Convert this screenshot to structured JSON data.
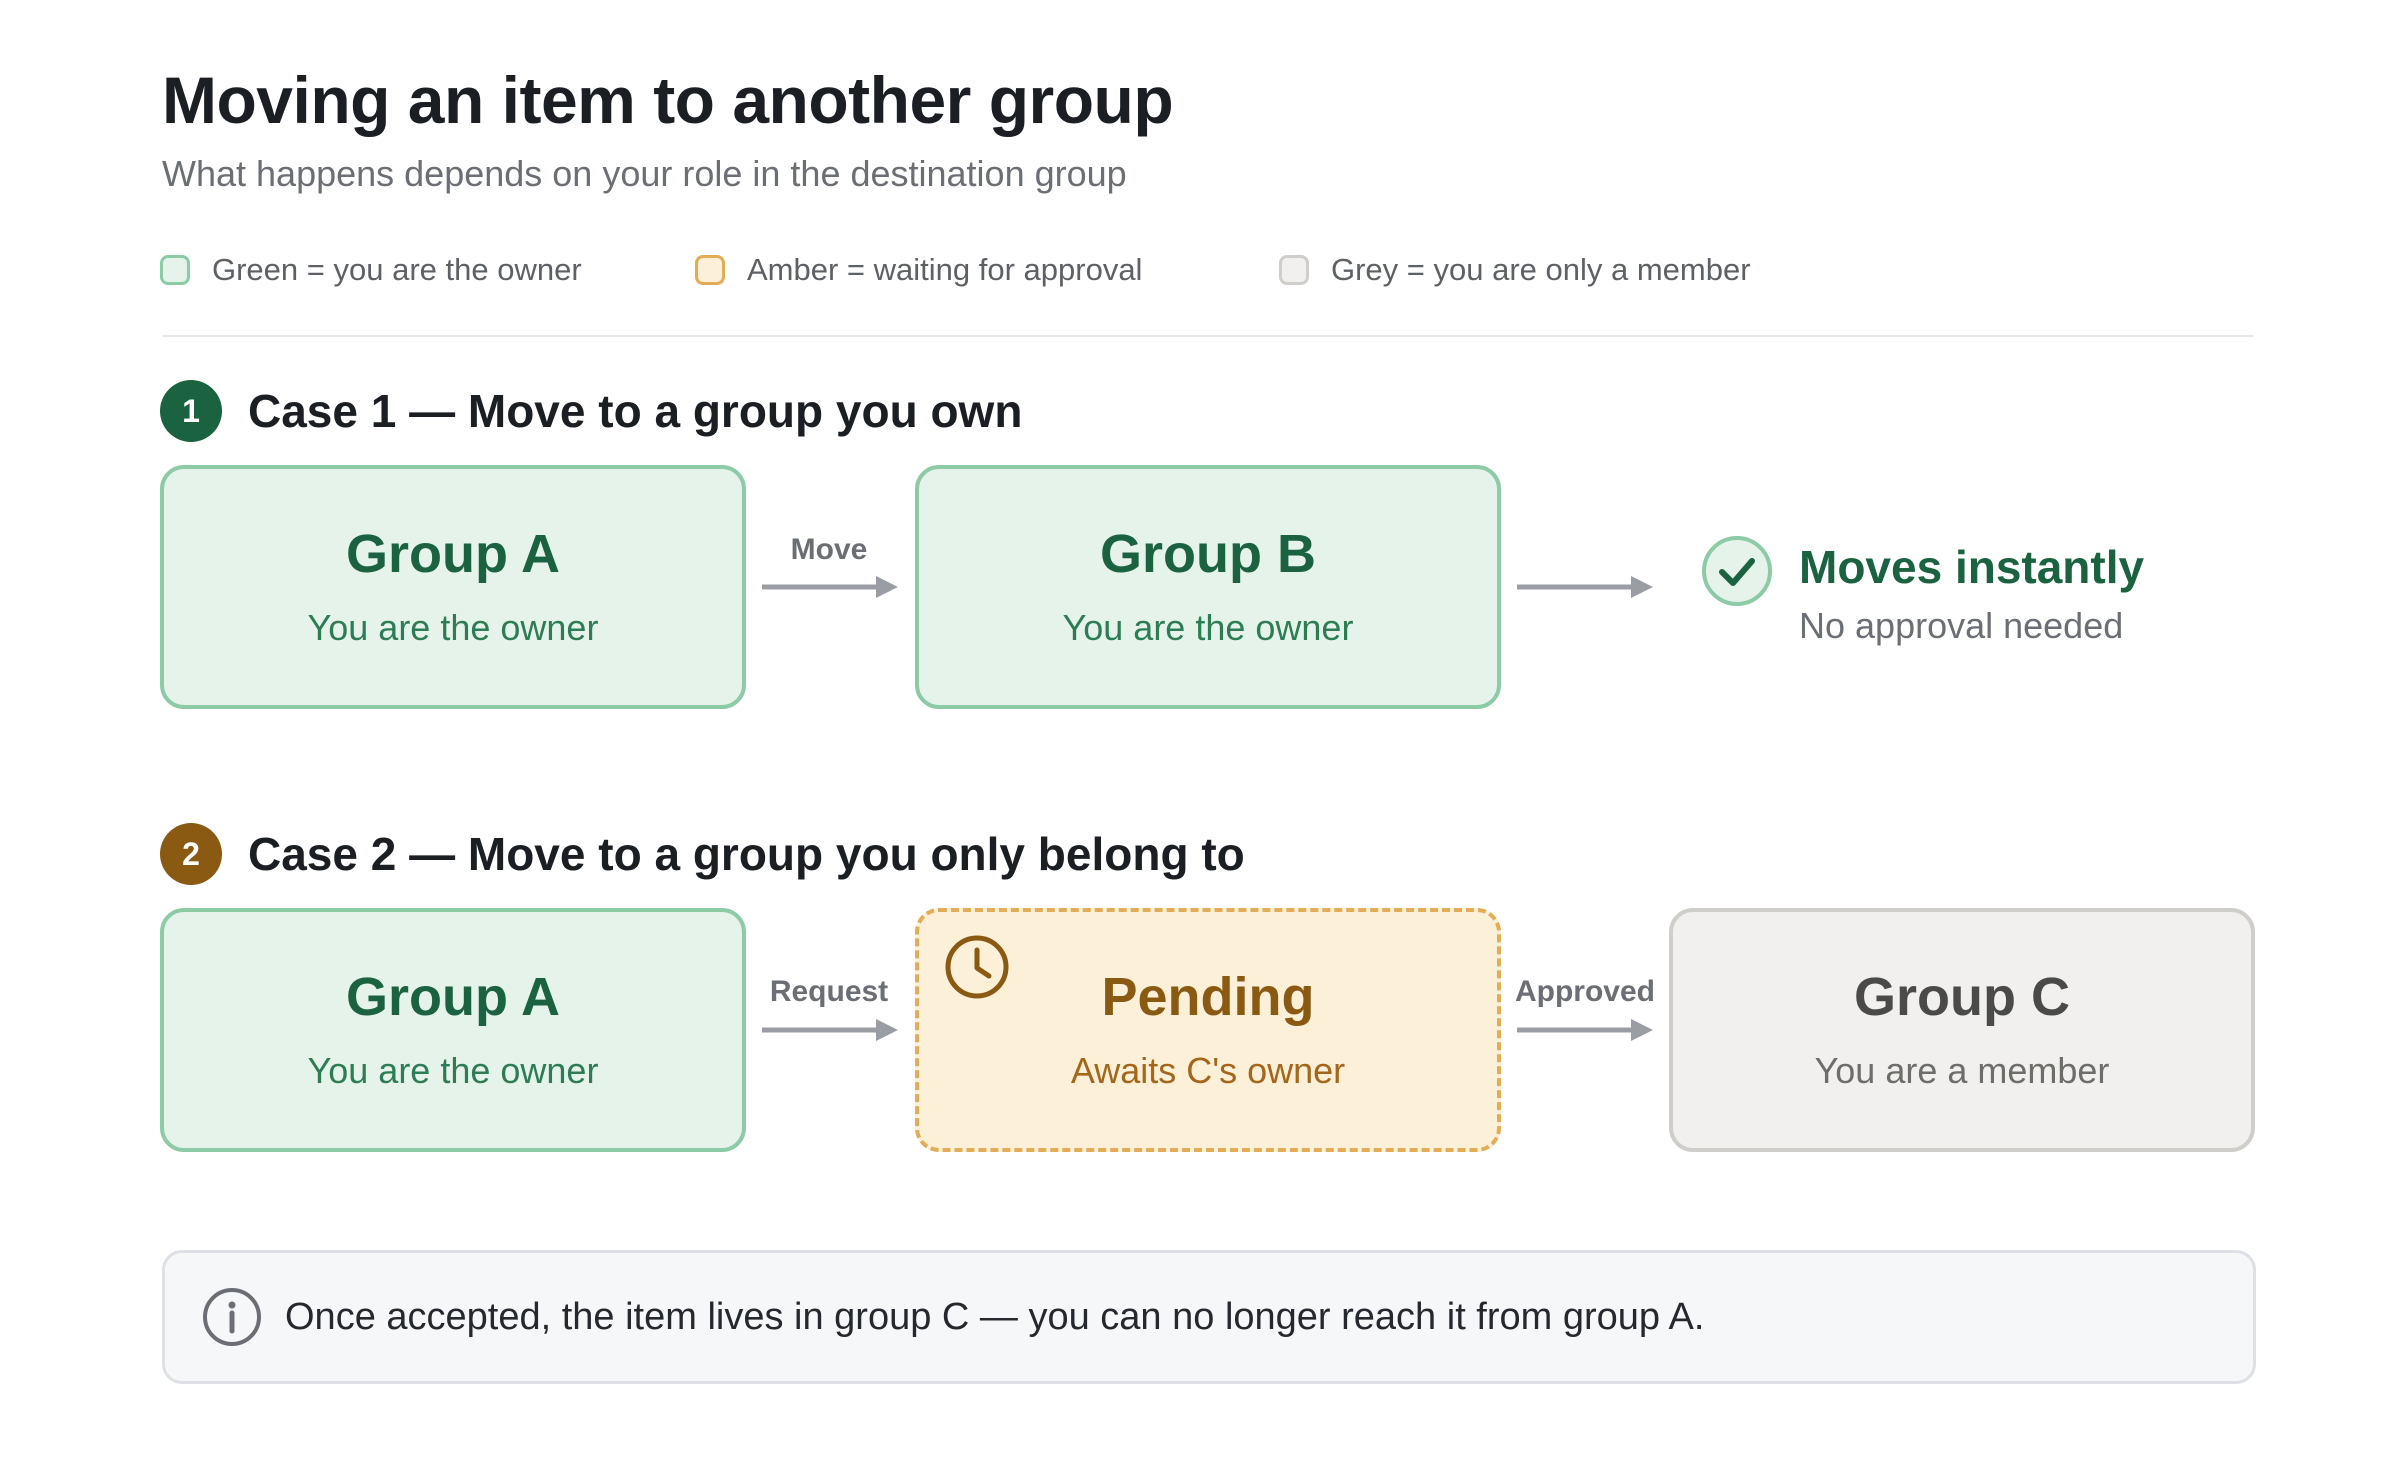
{
  "title": "Moving an item to another group",
  "subtitle": "What happens depends on your role in the destination group",
  "legend": [
    {
      "label": "Green = you are the owner",
      "fill": "#e6f3ea",
      "stroke": "#8ccba6"
    },
    {
      "label": "Amber = waiting for approval",
      "fill": "#fdf0d8",
      "stroke": "#e2ad56"
    },
    {
      "label": "Grey = you are only a member",
      "fill": "#f1f0ee",
      "stroke": "#cfcecb"
    }
  ],
  "case1": {
    "number": "1",
    "badge_color": "#1b6240",
    "title": "Case 1 — Move to a group you own",
    "source": {
      "title": "Group A",
      "subtitle": "You are the owner"
    },
    "arrow_label": "Move",
    "destination": {
      "title": "Group B",
      "subtitle": "You are the owner"
    },
    "result": {
      "icon": "check-circle-icon",
      "title": "Moves instantly",
      "subtitle": "No approval needed"
    }
  },
  "case2": {
    "number": "2",
    "badge_color": "#8a5a12",
    "title": "Case 2 — Move to a group you only belong to",
    "source": {
      "title": "Group A",
      "subtitle": "You are the owner"
    },
    "arrow1_label": "Request",
    "pending": {
      "icon": "clock-icon",
      "title": "Pending",
      "subtitle": "Awaits C's owner"
    },
    "arrow2_label": "Approved",
    "destination": {
      "title": "Group C",
      "subtitle": "You are a member"
    }
  },
  "note": {
    "icon": "info-icon",
    "text": "Once accepted, the item lives in group C — you can no longer reach it from group A."
  }
}
